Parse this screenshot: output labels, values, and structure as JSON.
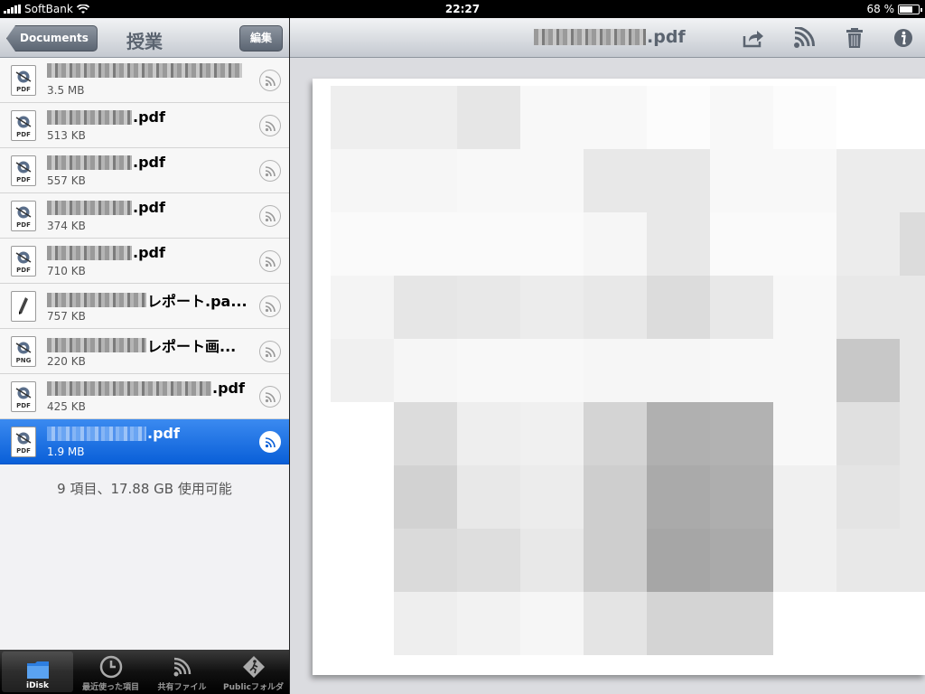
{
  "status_bar": {
    "carrier": "SoftBank",
    "time": "22:27",
    "battery": "68 %",
    "battery_level": 0.68
  },
  "left_nav": {
    "back_label": "Documents",
    "title": "授業",
    "edit_label": "編集"
  },
  "files": [
    {
      "name_suffix": "",
      "size": "3.5 MB",
      "type": "PDF",
      "blur_width": 216,
      "selected": false
    },
    {
      "name_suffix": ".pdf",
      "size": "513 KB",
      "type": "PDF",
      "blur_width": 94,
      "selected": false
    },
    {
      "name_suffix": ".pdf",
      "size": "557 KB",
      "type": "PDF",
      "blur_width": 94,
      "selected": false
    },
    {
      "name_suffix": ".pdf",
      "size": "374 KB",
      "type": "PDF",
      "blur_width": 94,
      "selected": false
    },
    {
      "name_suffix": ".pdf",
      "size": "710 KB",
      "type": "PDF",
      "blur_width": 94,
      "selected": false
    },
    {
      "name_suffix": "レポート.pa...",
      "size": "757 KB",
      "type": "PAGES",
      "blur_width": 110,
      "selected": false
    },
    {
      "name_suffix": "レポート画...",
      "size": "220 KB",
      "type": "PNG",
      "blur_width": 110,
      "selected": false
    },
    {
      "name_suffix": ".pdf",
      "size": "425 KB",
      "type": "PDF",
      "blur_width": 182,
      "selected": false
    },
    {
      "name_suffix": ".pdf",
      "size": "1.9 MB",
      "type": "PDF",
      "blur_width": 110,
      "selected": true
    }
  ],
  "summary": "9 項目、17.88 GB 使用可能",
  "tabs": [
    {
      "label": "iDisk",
      "icon": "folder-icon",
      "active": true
    },
    {
      "label": "最近使った項目",
      "icon": "clock-icon",
      "active": false
    },
    {
      "label": "共有ファイル",
      "icon": "rss-icon",
      "active": false
    },
    {
      "label": "Publicフォルダ",
      "icon": "public-sign-icon",
      "active": false
    }
  ],
  "document": {
    "title_suffix": ".pdf"
  },
  "colors": {
    "selection": "#0a5fd8",
    "nav_bar": "#c4c9d0"
  }
}
